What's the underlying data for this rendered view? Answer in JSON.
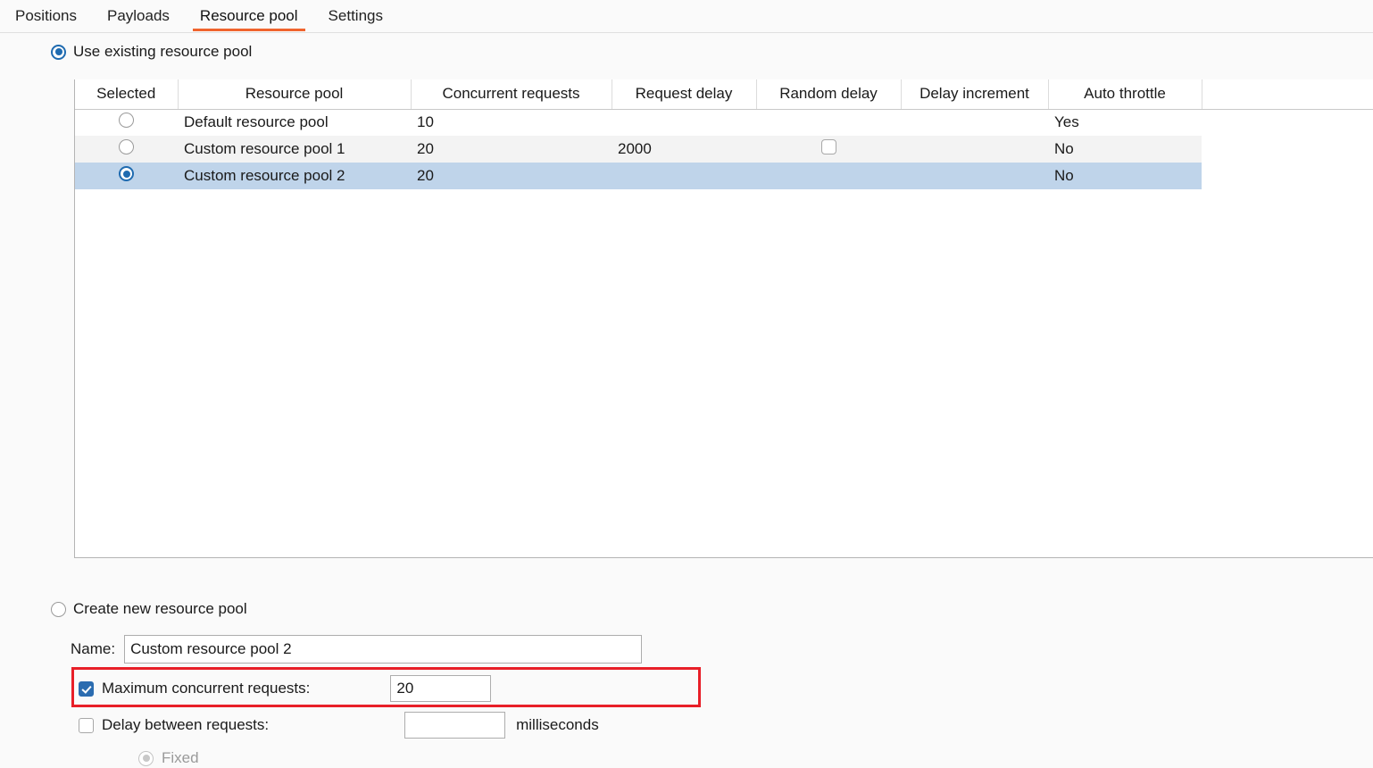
{
  "tabs": [
    {
      "label": "Positions",
      "active": false
    },
    {
      "label": "Payloads",
      "active": false
    },
    {
      "label": "Resource pool",
      "active": true
    },
    {
      "label": "Settings",
      "active": false
    }
  ],
  "mode": {
    "use_existing_label": "Use existing resource pool",
    "use_existing_selected": true,
    "create_new_label": "Create new resource pool",
    "create_new_selected": false
  },
  "table": {
    "headers": [
      "Selected",
      "Resource pool",
      "Concurrent requests",
      "Request delay",
      "Random delay",
      "Delay increment",
      "Auto throttle",
      ""
    ],
    "rows": [
      {
        "selected": false,
        "pool": "Default resource pool",
        "concurrent_requests": "10",
        "request_delay": "",
        "random_delay": "",
        "random_delay_checkbox": false,
        "delay_increment": "",
        "auto_throttle": "Yes",
        "row_style": "normal"
      },
      {
        "selected": false,
        "pool": "Custom resource pool 1",
        "concurrent_requests": "20",
        "request_delay": "2000",
        "random_delay": "",
        "random_delay_checkbox": true,
        "delay_increment": "",
        "auto_throttle": "No",
        "row_style": "alt"
      },
      {
        "selected": true,
        "pool": "Custom resource pool 2",
        "concurrent_requests": "20",
        "request_delay": "",
        "random_delay": "",
        "random_delay_checkbox": false,
        "delay_increment": "",
        "auto_throttle": "No",
        "row_style": "selected"
      }
    ]
  },
  "form": {
    "name_label": "Name:",
    "name_value": "Custom resource pool 2",
    "name_placeholder": "",
    "max_concurrent_label": "Maximum concurrent requests:",
    "max_concurrent_checked": true,
    "max_concurrent_value": "20",
    "delay_label": "Delay between requests:",
    "delay_checked": false,
    "delay_value": "",
    "delay_units": "milliseconds",
    "fixed_label": "Fixed",
    "fixed_selected": true,
    "fixed_disabled": true
  },
  "colors": {
    "accent": "#f0642e",
    "selection": "#bfd4ea",
    "radio_blue": "#1f6bb0",
    "checkbox_blue": "#2b6cb0",
    "highlight_red": "#e81f28",
    "background": "#fafafa"
  },
  "annotation": {
    "highlight_target": "max-concurrent-requests-row"
  }
}
